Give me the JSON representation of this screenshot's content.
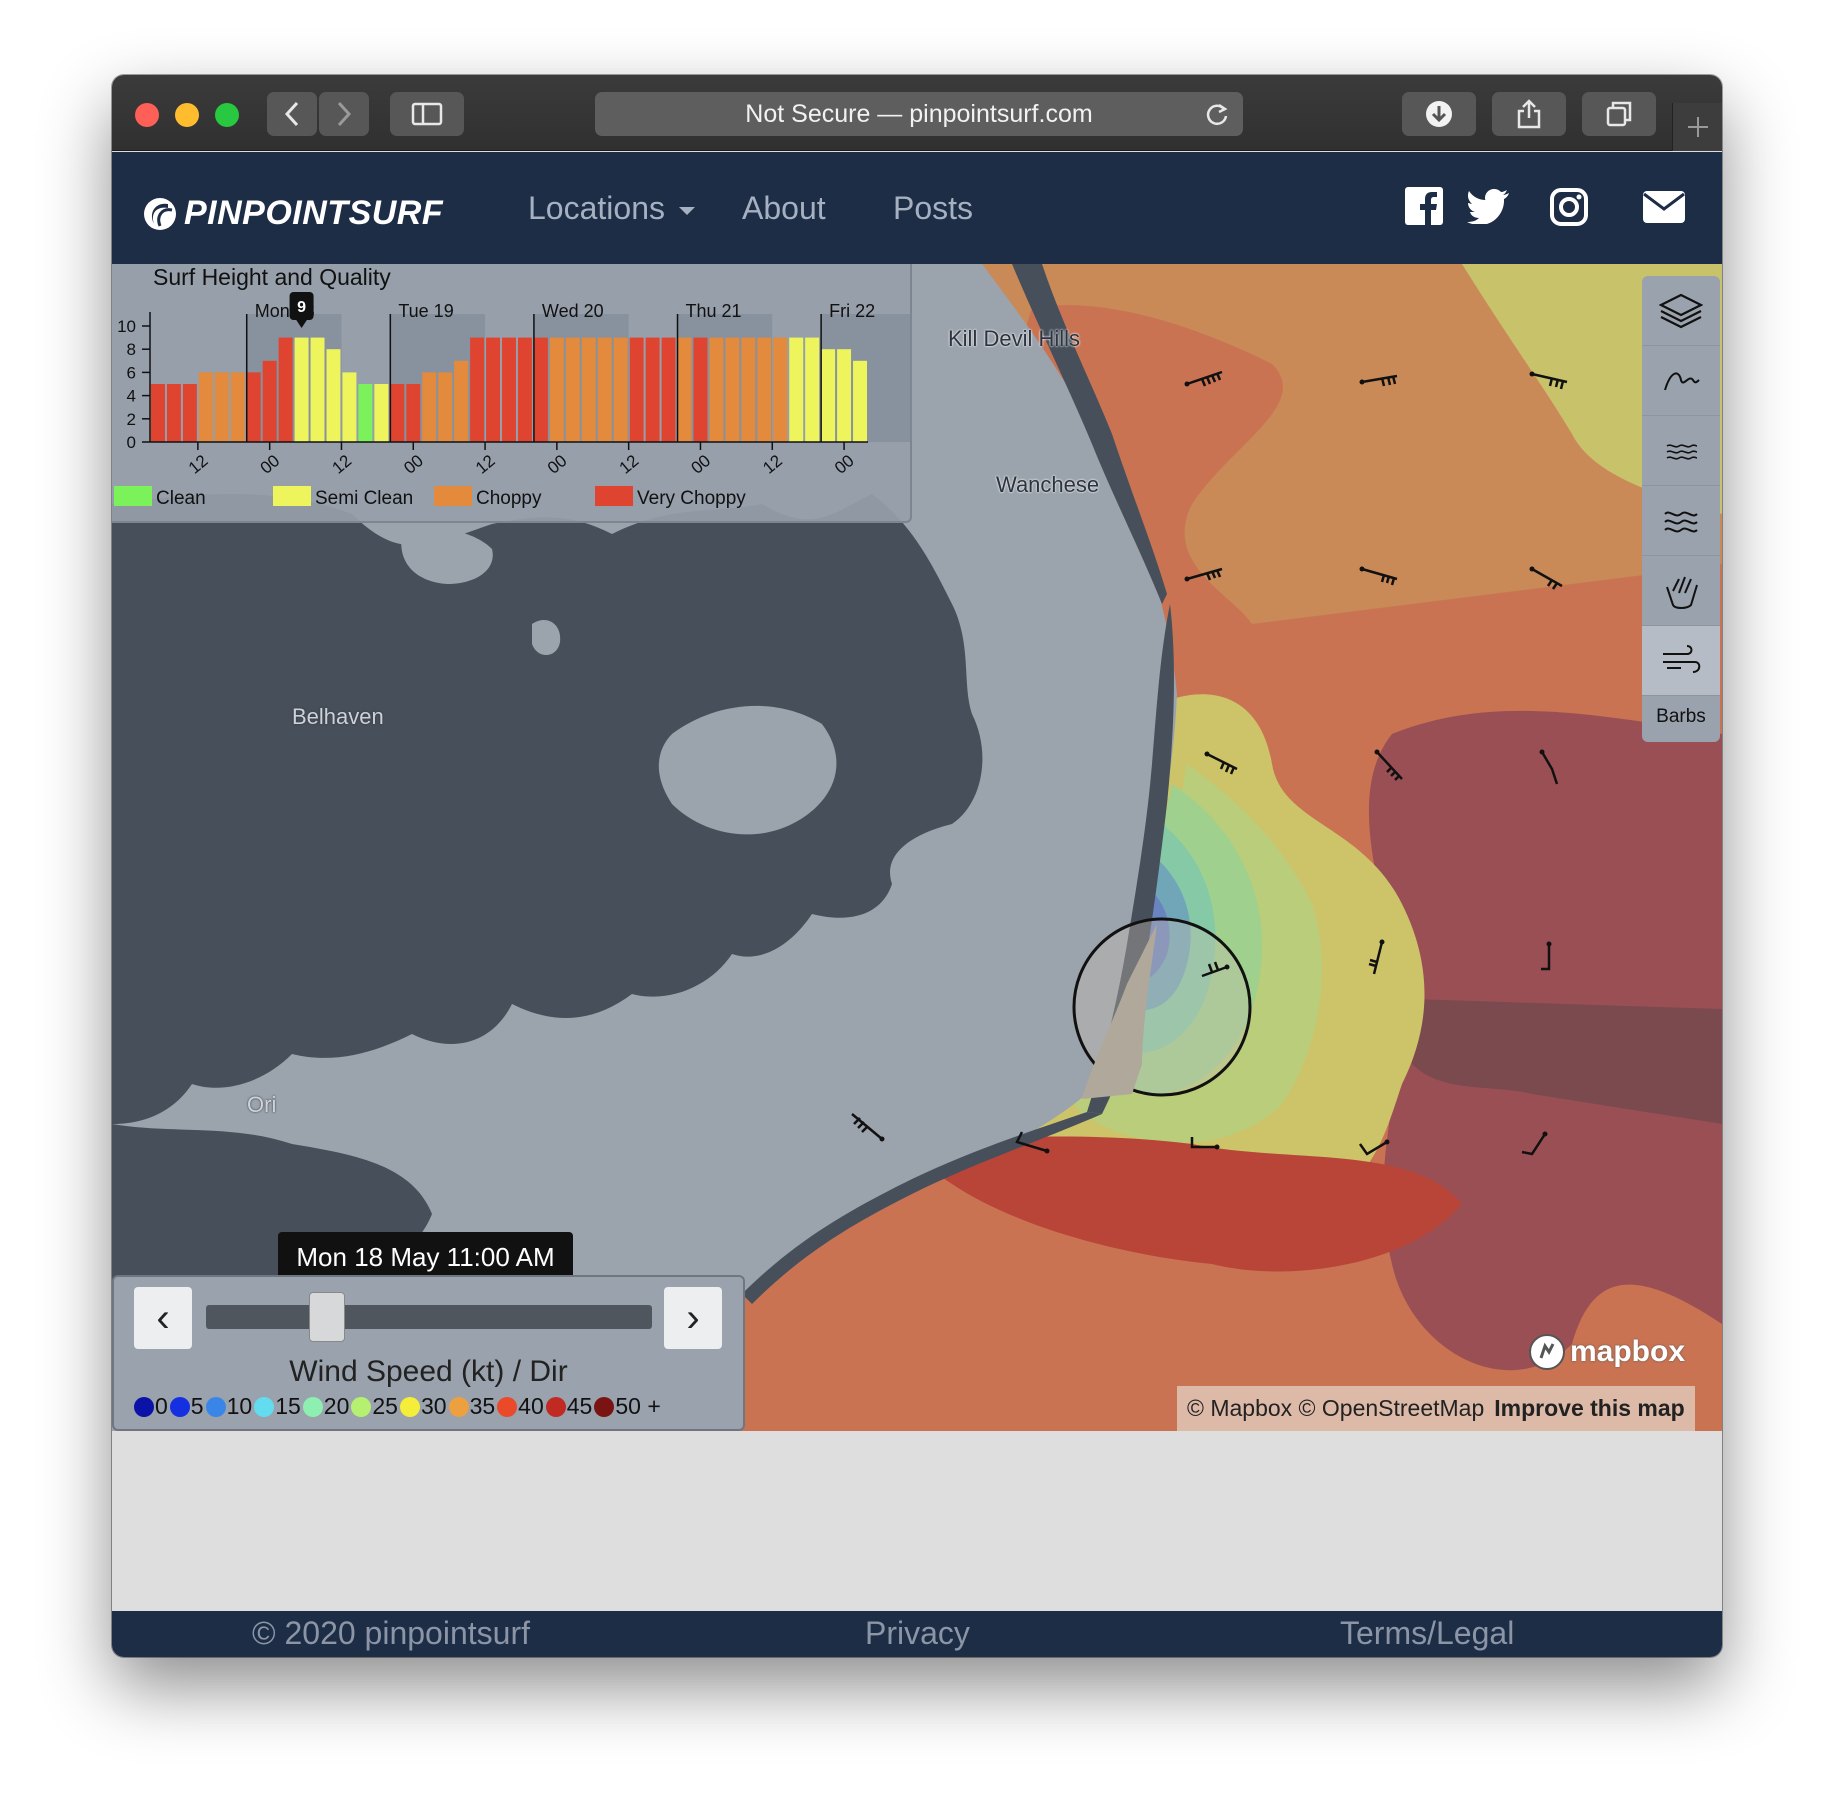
{
  "browser": {
    "address": "Not Secure — pinpointsurf.com"
  },
  "nav": {
    "brand": "PINPOINTSURF",
    "links": [
      "Locations",
      "About",
      "Posts"
    ]
  },
  "colors": {
    "navbar": "#1e2d46",
    "clean": "#7cf25a",
    "semi_clean": "#eef55c",
    "choppy": "#e38a3c",
    "very_choppy": "#de4430"
  },
  "map": {
    "labels": [
      "Kill Devil Hills",
      "Wanchese",
      "Belhaven",
      "Ori"
    ],
    "attribution": "© Mapbox © OpenStreetMap",
    "improve": "Improve this map",
    "logo": "mapbox"
  },
  "chart_data": {
    "type": "bar",
    "title": "Surf Height and Quality",
    "ylim": [
      0,
      10
    ],
    "yticks": [
      0,
      2,
      4,
      6,
      8,
      10
    ],
    "day_labels": [
      "Mon 18",
      "Tue 19",
      "Wed 20",
      "Thu 21",
      "Fri 22"
    ],
    "xtick_labels": [
      "12",
      "00",
      "12",
      "00",
      "12",
      "00",
      "12",
      "00",
      "12",
      "00"
    ],
    "selected_marker": "9",
    "values": [
      5,
      5,
      5,
      6,
      6,
      6,
      6,
      7,
      9,
      9,
      9,
      8,
      6,
      5,
      5,
      5,
      5,
      6,
      6,
      7,
      9,
      9,
      9,
      9,
      9,
      9,
      9,
      9,
      9,
      9,
      9,
      9,
      9,
      9,
      9,
      9,
      9,
      9,
      9,
      9,
      9,
      9,
      8,
      8,
      7
    ],
    "quality": [
      "vc",
      "vc",
      "vc",
      "ch",
      "ch",
      "ch",
      "vc",
      "vc",
      "vc",
      "sc",
      "sc",
      "sc",
      "sc",
      "cl",
      "sc",
      "vc",
      "vc",
      "ch",
      "ch",
      "ch",
      "vc",
      "vc",
      "vc",
      "vc",
      "vc",
      "ch",
      "ch",
      "ch",
      "ch",
      "ch",
      "vc",
      "vc",
      "vc",
      "ch",
      "vc",
      "ch",
      "ch",
      "ch",
      "ch",
      "ch",
      "sc",
      "sc",
      "sc",
      "sc",
      "sc"
    ],
    "legend": [
      {
        "key": "cl",
        "label": "Clean"
      },
      {
        "key": "sc",
        "label": "Semi Clean"
      },
      {
        "key": "ch",
        "label": "Choppy"
      },
      {
        "key": "vc",
        "label": "Very Choppy"
      }
    ]
  },
  "time_slider": {
    "label": "Mon 18 May 11:00 AM",
    "prev": "‹",
    "next": "›",
    "position": 0.25
  },
  "wind_legend": {
    "title": "Wind Speed (kt) / Dir",
    "stops": [
      {
        "v": "0",
        "c": "#0a12a8"
      },
      {
        "v": "5",
        "c": "#1530e0"
      },
      {
        "v": "10",
        "c": "#3a86e8"
      },
      {
        "v": "15",
        "c": "#62dcee"
      },
      {
        "v": "20",
        "c": "#8ef0b0"
      },
      {
        "v": "25",
        "c": "#b6f070"
      },
      {
        "v": "30",
        "c": "#f4ee3a"
      },
      {
        "v": "35",
        "c": "#eca040"
      },
      {
        "v": "40",
        "c": "#ea4a2a"
      },
      {
        "v": "45",
        "c": "#c02a22"
      },
      {
        "v": "50 +",
        "c": "#7a1412"
      }
    ]
  },
  "side_controls": {
    "active_label": "Barbs",
    "icons": [
      "layers-icon",
      "swell-icon",
      "sea-icon",
      "waves-icon",
      "shaka-icon",
      "wind-icon"
    ]
  },
  "footer": {
    "copyright": "© 2020 pinpointsurf",
    "privacy": "Privacy",
    "terms": "Terms/Legal"
  }
}
